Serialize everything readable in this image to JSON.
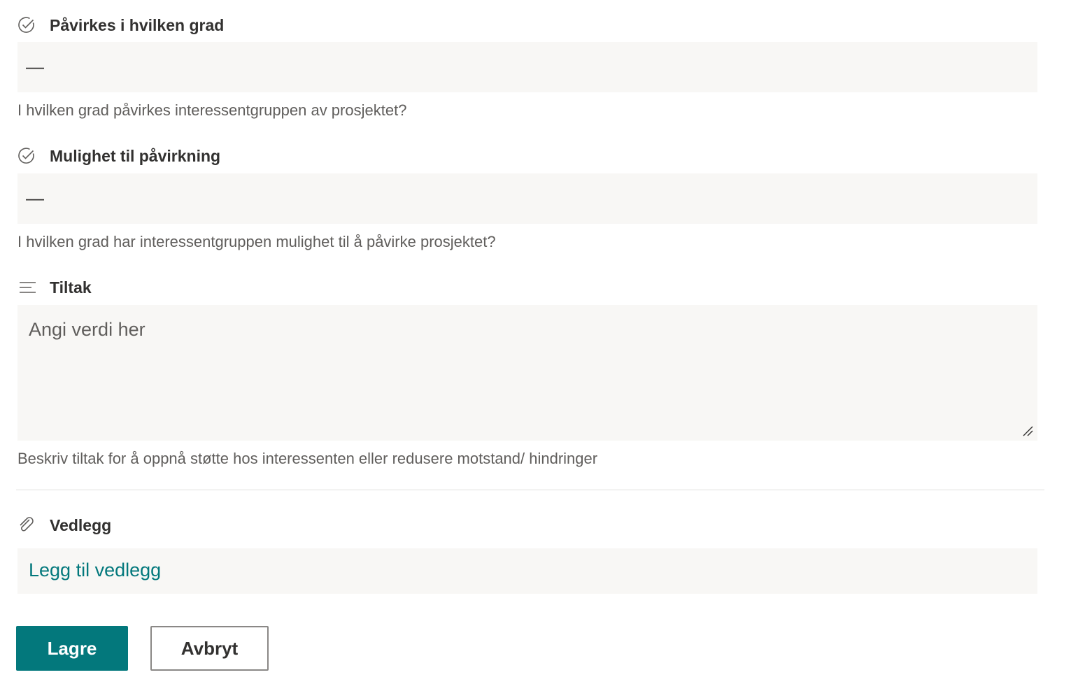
{
  "fields": {
    "impact": {
      "icon": "check-circle-icon",
      "title": "Påvirkes i hvilken grad",
      "value": "—",
      "help": "I hvilken grad påvirkes interessentgruppen av prosjektet?"
    },
    "influence": {
      "icon": "check-circle-icon",
      "title": "Mulighet til påvirkning",
      "value": "—",
      "help": "I hvilken grad har interessentgruppen mulighet til å påvirke prosjektet?"
    },
    "measures": {
      "icon": "multiline-text-icon",
      "title": "Tiltak",
      "value": "",
      "placeholder": "Angi verdi her",
      "help": "Beskriv tiltak for å oppnå støtte hos interessenten eller redusere motstand/ hindringer"
    },
    "attachments": {
      "icon": "paperclip-icon",
      "title": "Vedlegg",
      "link": "Legg til vedlegg"
    }
  },
  "buttons": {
    "save": "Lagre",
    "cancel": "Avbryt"
  },
  "colors": {
    "accent": "#03787c",
    "field_bg": "#f8f7f5",
    "text": "#323130",
    "help_text": "#605e5c",
    "divider": "#e1dfdd"
  }
}
